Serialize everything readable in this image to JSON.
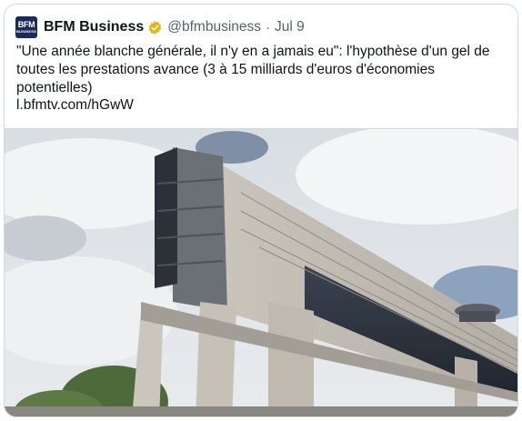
{
  "tweet": {
    "avatar_text_main": "BFM",
    "avatar_text_sub": "BUSINESS",
    "display_name": "BFM Business",
    "handle": "@bfmbusiness",
    "separator": "·",
    "date": "Jul 9",
    "text": "\"Une année blanche générale, il n'y en a jamais eu\": l'hypothèse d'un gel de toutes les prestations avance (3 à 15 milliards d'euros d'économies potentielles)",
    "link": "l.bfmtv.com/hGwW",
    "verified_badge_icon": "verified-gold-badge-icon",
    "verified_badge_color": "#e2b719",
    "avatar_color": "#1a2a5a"
  },
  "media": {
    "image_subject": "ministry-building-photo"
  }
}
